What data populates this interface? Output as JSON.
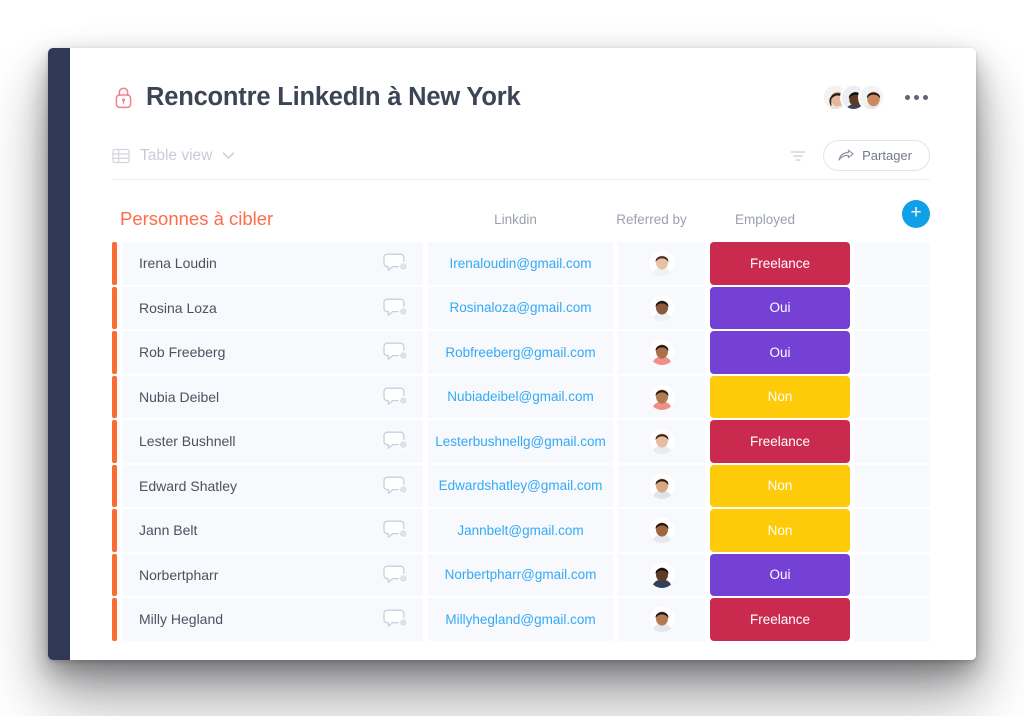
{
  "header": {
    "lock_icon": "lock-icon",
    "title": "Rencontre LinkedIn à New York",
    "avatars": [
      {
        "name": "collaborator-avatar-1",
        "skin": "#e3b79a",
        "hair": "#2e2118"
      },
      {
        "name": "collaborator-avatar-2",
        "skin": "#5a3b28",
        "hair": "#14100c"
      },
      {
        "name": "collaborator-avatar-3",
        "skin": "#c98a62",
        "hair": "#241a12"
      }
    ],
    "more_menu": "more-options"
  },
  "view_bar": {
    "view_icon": "table-icon",
    "view_label": "Table view",
    "chevron": "chevron-down-icon",
    "filter_icon": "filter-icon",
    "share_icon": "share-arrow-icon",
    "share_label": "Partager"
  },
  "table": {
    "group_title": "Personnes à cibler",
    "columns": [
      {
        "key": "name",
        "label": ""
      },
      {
        "key": "linkedin",
        "label": "Linkdin"
      },
      {
        "key": "referred_by",
        "label": "Referred by"
      },
      {
        "key": "employed",
        "label": "Employed"
      }
    ],
    "add_column_label": "+",
    "row_accent_color": "#fc6b31",
    "chat_icon": "chat-bubble-icon",
    "status_colors": {
      "Freelance": "#c92a4e",
      "Oui": "#7540d4",
      "Non": "#fdcb09"
    },
    "rows": [
      {
        "name": "Irena Loudin",
        "linkedin": "Irenaloudin@gmail.com",
        "employed": "Freelance",
        "avatar": {
          "skin": "#e8c0a4",
          "hair": "#4a3326",
          "shirt": "#f0f2f6"
        }
      },
      {
        "name": "Rosina Loza",
        "linkedin": "Rosinaloza@gmail.com",
        "employed": "Oui",
        "avatar": {
          "skin": "#8a5a3c",
          "hair": "#1b130e",
          "shirt": "#eef1f5"
        }
      },
      {
        "name": "Rob Freeberg",
        "linkedin": "Robfreeberg@gmail.com",
        "employed": "Oui",
        "avatar": {
          "skin": "#a9704a",
          "hair": "#221710",
          "shirt": "#ef8f87"
        }
      },
      {
        "name": "Nubia Deibel",
        "linkedin": "Nubiadeibel@gmail.com",
        "employed": "Non",
        "avatar": {
          "skin": "#b07a52",
          "hair": "#241a12",
          "shirt": "#ef8f87"
        }
      },
      {
        "name": "Lester Bushnell",
        "linkedin": "Lesterbushnellg@gmail.com",
        "employed": "Freelance",
        "avatar": {
          "skin": "#e6bda0",
          "hair": "#3a2718",
          "shirt": "#e8ebf0"
        }
      },
      {
        "name": "Edward Shatley",
        "linkedin": "Edwardshatley@gmail.com",
        "employed": "Non",
        "avatar": {
          "skin": "#d9a77f",
          "hair": "#2a1d14",
          "shirt": "#dfe3ea"
        }
      },
      {
        "name": "Jann Belt",
        "linkedin": "Jannbelt@gmail.com",
        "employed": "Non",
        "avatar": {
          "skin": "#9d6540",
          "hair": "#1e1510",
          "shirt": "#e5e8ee"
        }
      },
      {
        "name": "Norbertpharr",
        "linkedin": "Norbertpharr@gmail.com",
        "employed": "Oui",
        "avatar": {
          "skin": "#5e3d27",
          "hair": "#120d09",
          "shirt": "#31405c"
        }
      },
      {
        "name": "Milly Hegland",
        "linkedin": "Millyhegland@gmail.com",
        "employed": "Freelance",
        "avatar": {
          "skin": "#b37a52",
          "hair": "#1c1410",
          "shirt": "#e4e7ee"
        }
      }
    ]
  },
  "colors": {
    "accent_orange": "#ff6b4a",
    "row_accent": "#fc6b31",
    "link_blue": "#33aaf5",
    "add_button_blue": "#10a0e8",
    "sidebar": "#2f3856",
    "lock_pink": "#f3808f"
  }
}
